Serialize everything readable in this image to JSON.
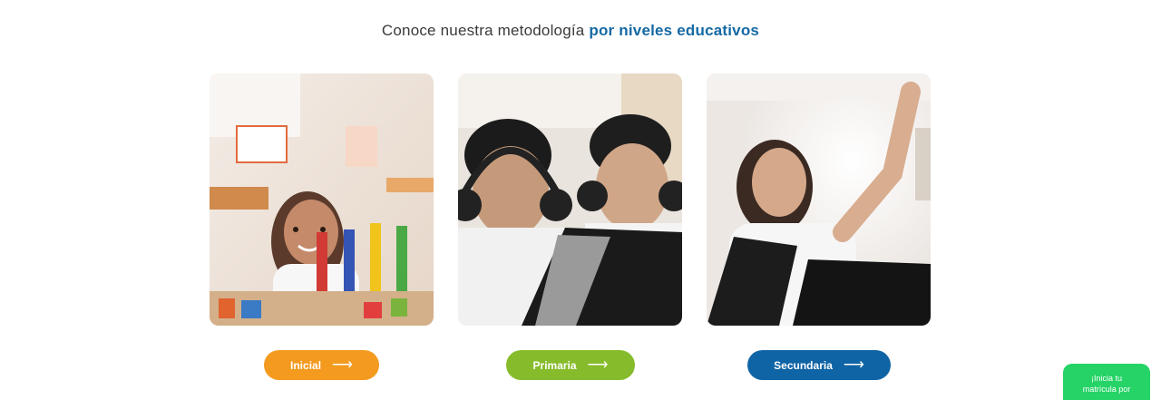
{
  "section": {
    "title_regular": "Conoce nuestra metodología",
    "title_bold": "por niveles educativos"
  },
  "levels": [
    {
      "label": "Inicial",
      "color": "#f39a1f",
      "image": "photo-preschool-girl-with-blocks"
    },
    {
      "label": "Primaria",
      "color": "#86bc2b",
      "image": "photo-boys-with-headphones-and-laptop"
    },
    {
      "label": "Secundaria",
      "color": "#0f64a6",
      "image": "photo-girl-raising-hand-with-laptops"
    }
  ],
  "arrow_icon": "arrow-right-icon",
  "chat_widget": {
    "line1": "¡Inicia tu",
    "line2": "matrícula por",
    "color": "#25d366"
  },
  "accent_color": "#1569a4"
}
